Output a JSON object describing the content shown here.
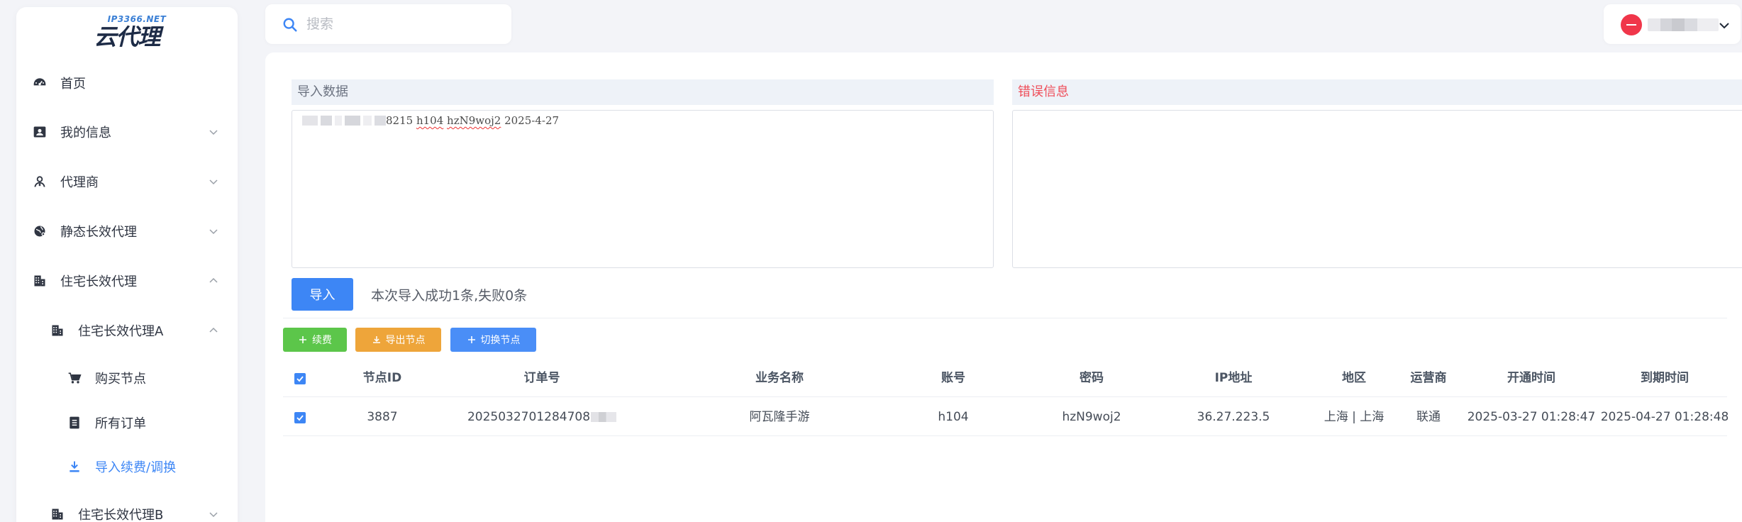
{
  "logo": {
    "sub": "IP3366.NET",
    "main": "云代理"
  },
  "sidebar": {
    "items": [
      {
        "label": "首页",
        "icon": "dashboard-icon"
      },
      {
        "label": "我的信息",
        "icon": "id-card-icon"
      },
      {
        "label": "代理商",
        "icon": "agent-icon"
      },
      {
        "label": "静态长效代理",
        "icon": "globe-icon"
      },
      {
        "label": "住宅长效代理",
        "icon": "building-icon"
      },
      {
        "label": "住宅长效代理A",
        "icon": "building-icon"
      },
      {
        "label": "购买节点",
        "icon": "cart-icon"
      },
      {
        "label": "所有订单",
        "icon": "list-icon"
      },
      {
        "label": "导入续费/调换",
        "icon": "download-icon",
        "active": true
      },
      {
        "label": "住宅长效代理B",
        "icon": "building-icon"
      }
    ]
  },
  "search": {
    "placeholder": "搜索"
  },
  "user": {
    "name": ""
  },
  "import": {
    "data_title": "导入数据",
    "error_title": "错误信息",
    "data_text_suffix": "8215 ",
    "data_text_account": "h104",
    "data_text_password": "hzN9woj2",
    "data_text_date": " 2025-4-27",
    "button": "导入",
    "result": "本次导入成功1条,失败0条"
  },
  "toolbar": {
    "renew": "续费",
    "export": "导出节点",
    "switch": "切换节点"
  },
  "table": {
    "headers": [
      "节点ID",
      "订单号",
      "业务名称",
      "账号",
      "密码",
      "IP地址",
      "地区",
      "运营商",
      "开通时间",
      "到期时间"
    ],
    "rows": [
      {
        "node_id": "3887",
        "order_no": "2025032701284708",
        "service": "阿瓦隆手游",
        "account": "h104",
        "password": "hzN9woj2",
        "ip": "36.27.223.5",
        "region": "上海 | 上海",
        "isp": "联通",
        "open_time": "2025-03-27 01:28:47",
        "expire_time": "2025-04-27 01:28:48"
      }
    ]
  },
  "colors": {
    "primary": "#3d86f5",
    "success": "#5cc64a",
    "warning": "#eea53a",
    "danger": "#ef4e5a",
    "avatar": "#f0364a"
  }
}
